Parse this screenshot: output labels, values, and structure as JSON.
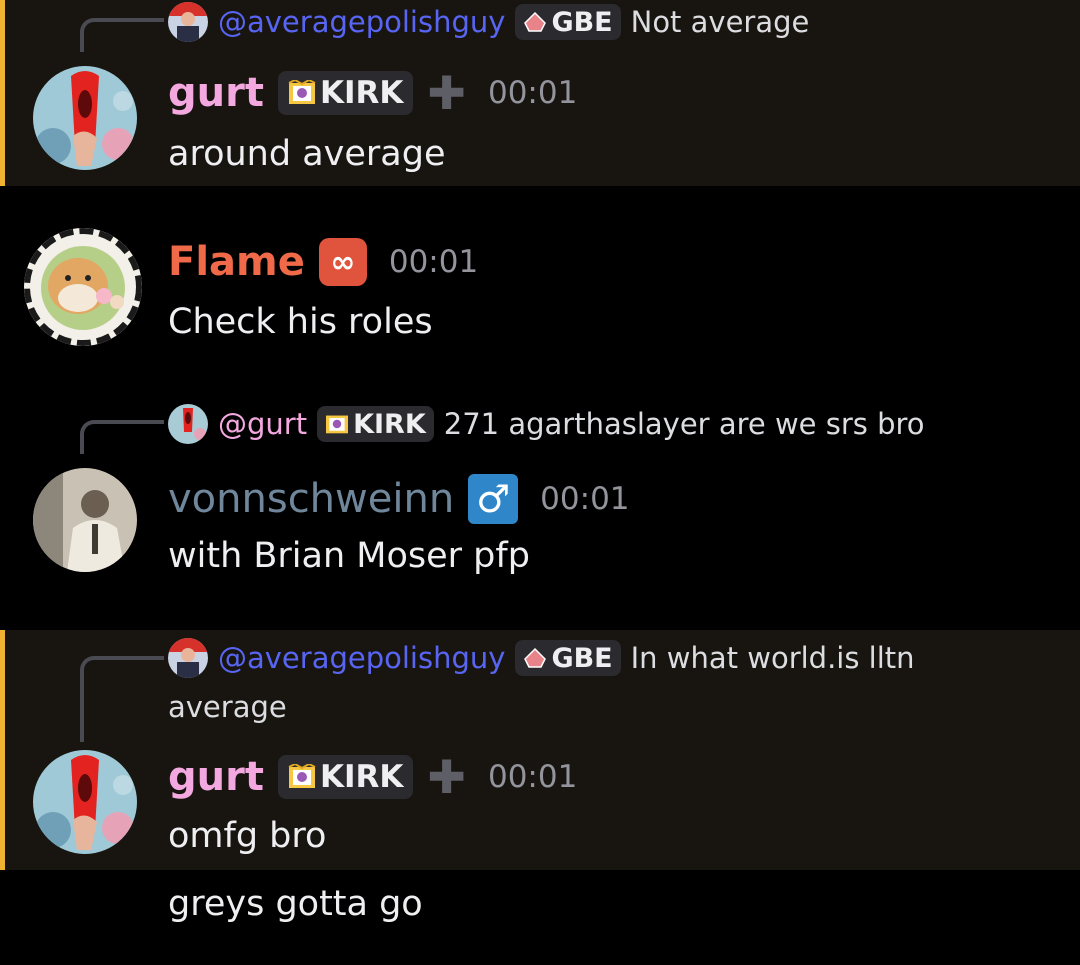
{
  "colors": {
    "background": "#000000",
    "highlight_bg": "#181511",
    "highlight_bar": "#f0b232",
    "mention_blue": "#5865f2",
    "gurt_pink": "#f3a8e0",
    "flame_orange": "#f06a4a",
    "vonn_slate": "#70879b",
    "timestamp": "#93949c"
  },
  "messages": [
    {
      "reply": {
        "mention": "@averagepolishguy",
        "tag": "GBE",
        "text": "Not average",
        "icon": "gbe-badge-icon"
      },
      "author": "gurt",
      "tag": "KIRK",
      "tag_icon": "kirk-crown-icon",
      "time": "00:01",
      "content": "around average"
    },
    {
      "author": "Flame",
      "badge_icon": "infinity-badge-icon",
      "time": "00:01",
      "content": "Check his roles"
    },
    {
      "reply": {
        "mention": "@gurt",
        "tag": "KIRK",
        "text": "271 agarthaslayer are we srs bro",
        "icon": "kirk-crown-icon"
      },
      "author": "vonnschweinn",
      "badge_icon": "male-sign-icon",
      "badge_glyph": "♂",
      "time": "00:01",
      "content": "with Brian Moser pfp"
    },
    {
      "reply": {
        "mention": "@averagepolishguy",
        "tag": "GBE",
        "text": "In what world.is lltn",
        "text_line2": "average",
        "icon": "gbe-badge-icon"
      },
      "author": "gurt",
      "tag": "KIRK",
      "tag_icon": "kirk-crown-icon",
      "time": "00:01",
      "content": "omfg bro",
      "followup": "greys gotta go"
    }
  ]
}
